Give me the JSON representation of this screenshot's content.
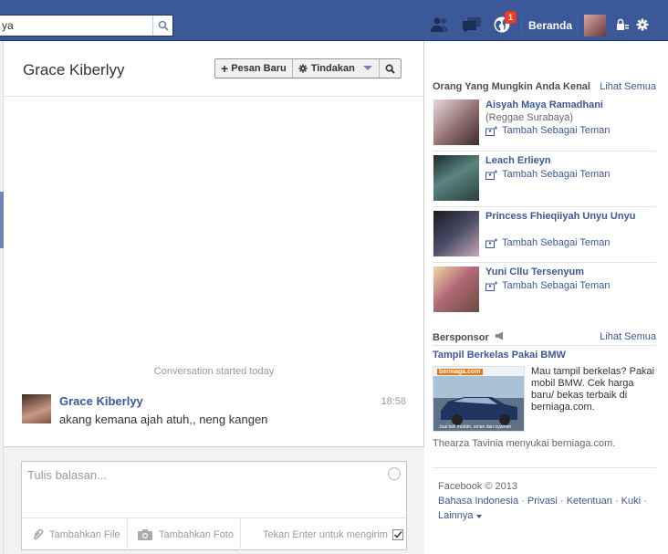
{
  "topbar": {
    "search_value": "ya",
    "home_label": "Beranda",
    "notification_count": "1"
  },
  "conversation": {
    "title": "Grace Kiberlyy",
    "new_message_label": "Pesan Baru",
    "actions_label": "Tindakan",
    "started_text": "Conversation started today",
    "message": {
      "sender": "Grace Kiberlyy",
      "time": "18:58",
      "text": "akang kemana ajah atuh,, neng kangen"
    },
    "reply_placeholder": "Tulis balasan...",
    "add_file_label": "Tambahkan File",
    "add_photo_label": "Tambahkan Foto",
    "enter_to_send_label": "Tekan Enter untuk mengirim"
  },
  "people_you_may_know": {
    "title": "Orang Yang Mungkin Anda Kenal",
    "see_all": "Lihat Semua",
    "add_friend_label": "Tambah Sebagai Teman",
    "people": [
      {
        "name": "Aisyah Maya Ramadhani",
        "sub": "(Reggae Surabaya)"
      },
      {
        "name": "Leach Erlieyn",
        "sub": ""
      },
      {
        "name": "Princess Fhieqiiyah Unyu Unyu",
        "sub": ""
      },
      {
        "name": "Yuni Cllu Tersenyum",
        "sub": ""
      }
    ]
  },
  "sponsored": {
    "title": "Bersponsor",
    "see_all": "Lihat Semua",
    "ad_title": "Tampil Berkelas Pakai BMW",
    "ad_text": "Mau tampil berkelas? Pakai mobil BMW. Cek harga baru/ bekas terbaik di berniaga.com.",
    "ad_brand": "berniaga.com",
    "ad_tagline": "Jual beli mudah, aman dan nyaman",
    "social_text": "Thearza Tavinia menyukai berniaga.com."
  },
  "footer": {
    "copyright": "Facebook © 2013",
    "links": [
      "Bahasa Indonesia",
      "Privasi",
      "Ketentuan",
      "Kuki",
      "Lainnya"
    ]
  },
  "colors": {
    "brand": "#3b5998",
    "notification": "#f03d25"
  }
}
